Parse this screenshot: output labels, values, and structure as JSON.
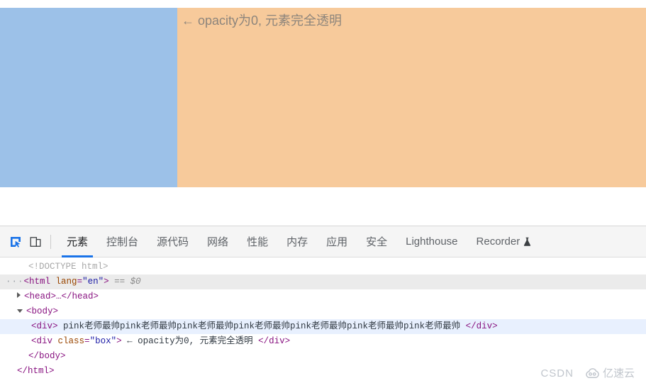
{
  "viewport": {
    "blue_box": {
      "name": "blue-block",
      "color": "#9cc1e8"
    },
    "orange_box": {
      "name": "orange-block",
      "color": "#f7ca9b",
      "text": "← opacity为0, 元素完全透明",
      "text_color": "#8d857c"
    }
  },
  "devtools": {
    "toolbar": {
      "inspect_icon": "inspect-element-icon",
      "inspect_icon_color": "#1a73e8",
      "device_icon": "device-toolbar-icon",
      "device_icon_color": "#5f6368"
    },
    "tabs": [
      {
        "label": "元素",
        "active": true,
        "icon": null
      },
      {
        "label": "控制台",
        "active": false,
        "icon": null
      },
      {
        "label": "源代码",
        "active": false,
        "icon": null
      },
      {
        "label": "网络",
        "active": false,
        "icon": null
      },
      {
        "label": "性能",
        "active": false,
        "icon": null
      },
      {
        "label": "内存",
        "active": false,
        "icon": null
      },
      {
        "label": "应用",
        "active": false,
        "icon": null
      },
      {
        "label": "安全",
        "active": false,
        "icon": null
      },
      {
        "label": "Lighthouse",
        "active": false,
        "icon": null
      },
      {
        "label": "Recorder",
        "active": false,
        "icon": "flask-icon"
      }
    ],
    "active_tab_underline_color": "#1a73e8",
    "dom_tree": {
      "doctype": "<!DOCTYPE html>",
      "html_open": {
        "dots": "···",
        "tag_open": "<html",
        "attr_name": "lang",
        "attr_eq": "=",
        "attr_value": "\"en\"",
        "tag_close": ">",
        "equals": "==",
        "selector": "$0"
      },
      "head_row": "<head>…</head>",
      "body_open": "<body>",
      "div_plain": {
        "open": "<div>",
        "text": "pink老师最帅pink老师最帅pink老师最帅pink老师最帅pink老师最帅pink老师最帅pink老师最帅",
        "close": "</div>"
      },
      "div_box": {
        "open_tag": "<div",
        "attr_name": "class",
        "attr_eq": "=",
        "attr_value": "\"box\"",
        "open_close": ">",
        "text": "← opacity为0, 元素完全透明",
        "close": "</div>"
      },
      "body_close": "</body>",
      "html_close": "</html>"
    }
  },
  "watermark": {
    "csdn": "CSDN",
    "yisu": "亿速云",
    "cloud_icon": "cloud-logo-icon"
  }
}
